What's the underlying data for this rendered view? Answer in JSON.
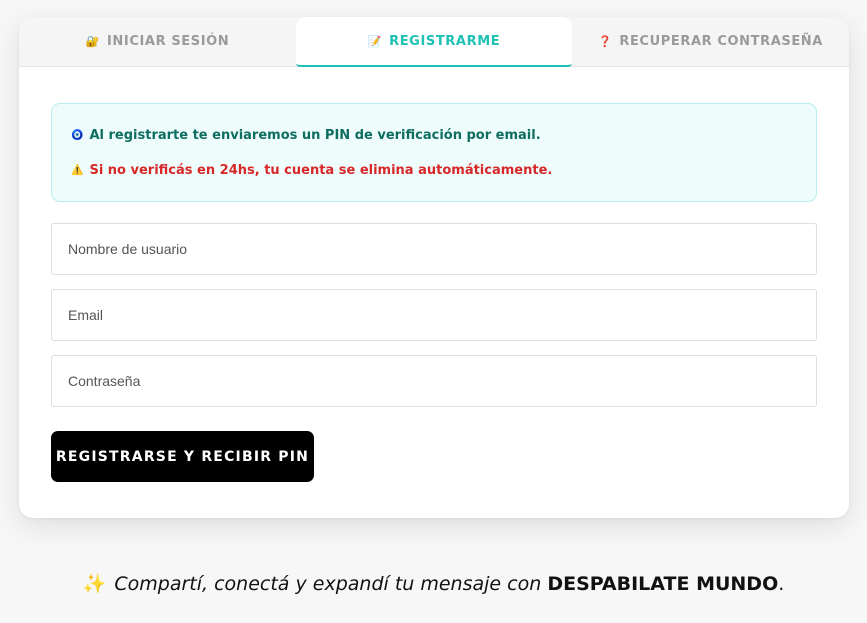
{
  "tabs": [
    {
      "icon": "🔐",
      "icon_name": "lock-with-key-icon",
      "label": "INICIAR SESIÓN"
    },
    {
      "icon": "📝",
      "icon_name": "memo-icon",
      "label": "REGISTRARME"
    },
    {
      "icon": "❓",
      "icon_name": "question-mark-icon",
      "label": "RECUPERAR CONTRASEÑA"
    }
  ],
  "active_tab": "REGISTRARME",
  "notice": {
    "info_icon": "🧿",
    "info_text": "Al registrarte te enviaremos un PIN de verificación por email.",
    "warn_icon": "⚠️",
    "warn_text": "Si no verificás en 24hs, tu cuenta se elimina automáticamente."
  },
  "form": {
    "username_placeholder": "Nombre de usuario",
    "email_placeholder": "Email",
    "password_placeholder": "Contraseña",
    "submit_label": "REGISTRARSE Y RECIBIR PIN"
  },
  "footer": {
    "sparkle": "✨",
    "tagline": "Compartí, conectá y expandí tu mensaje con",
    "brand": "DESPABILATE MUNDO",
    "end": "."
  },
  "colors": {
    "accent": "#1ec2b5",
    "info_text": "#0d6e60",
    "warning_text": "#d62828",
    "notice_bg": "#effcfc",
    "button_bg": "#000000"
  }
}
